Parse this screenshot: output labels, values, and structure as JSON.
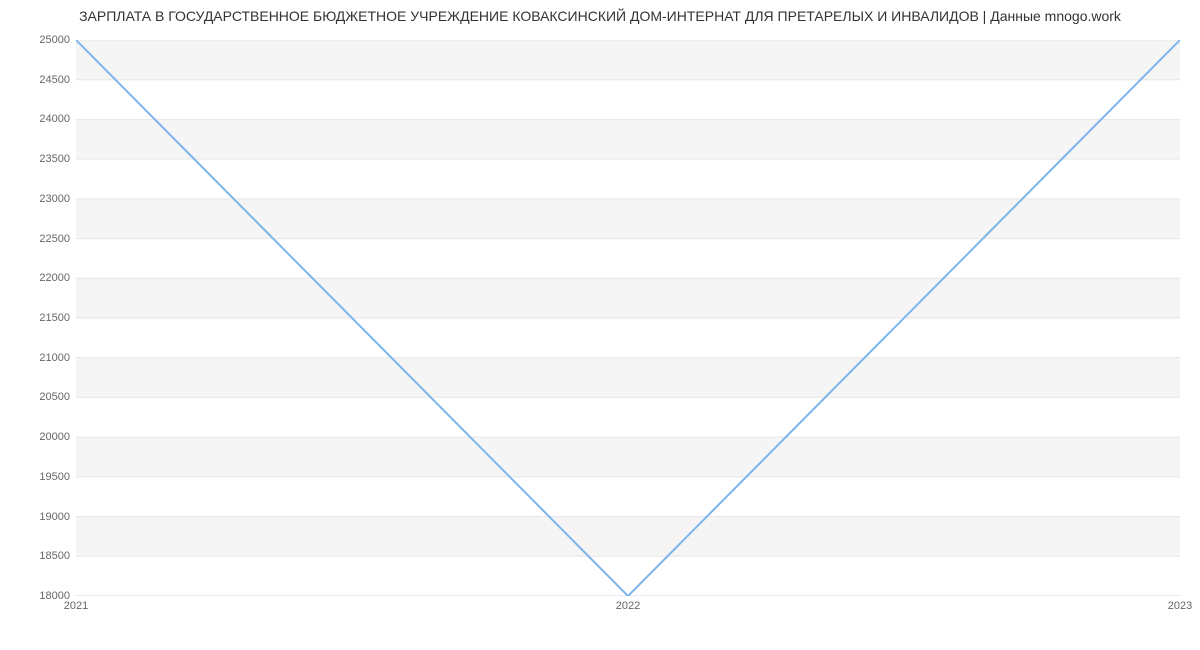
{
  "chart_data": {
    "type": "line",
    "title": "ЗАРПЛАТА В ГОСУДАРСТВЕННОЕ БЮДЖЕТНОЕ УЧРЕЖДЕНИЕ КОВАКСИНСКИЙ ДОМ-ИНТЕРНАТ ДЛЯ ПРЕТАРЕЛЫХ И ИНВАЛИДОВ | Данные mnogo.work",
    "xlabel": "",
    "ylabel": "",
    "x": [
      "2021",
      "2022",
      "2023"
    ],
    "values": [
      25000,
      18000,
      25000
    ],
    "ylim": [
      18000,
      25000
    ],
    "y_ticks": [
      18000,
      18500,
      19000,
      19500,
      20000,
      20500,
      21000,
      21500,
      22000,
      22500,
      23000,
      23500,
      24000,
      24500,
      25000
    ],
    "line_color": "#7cb5ec",
    "grid": {
      "on": true,
      "alt_band_color": "#f5f5f5"
    }
  }
}
